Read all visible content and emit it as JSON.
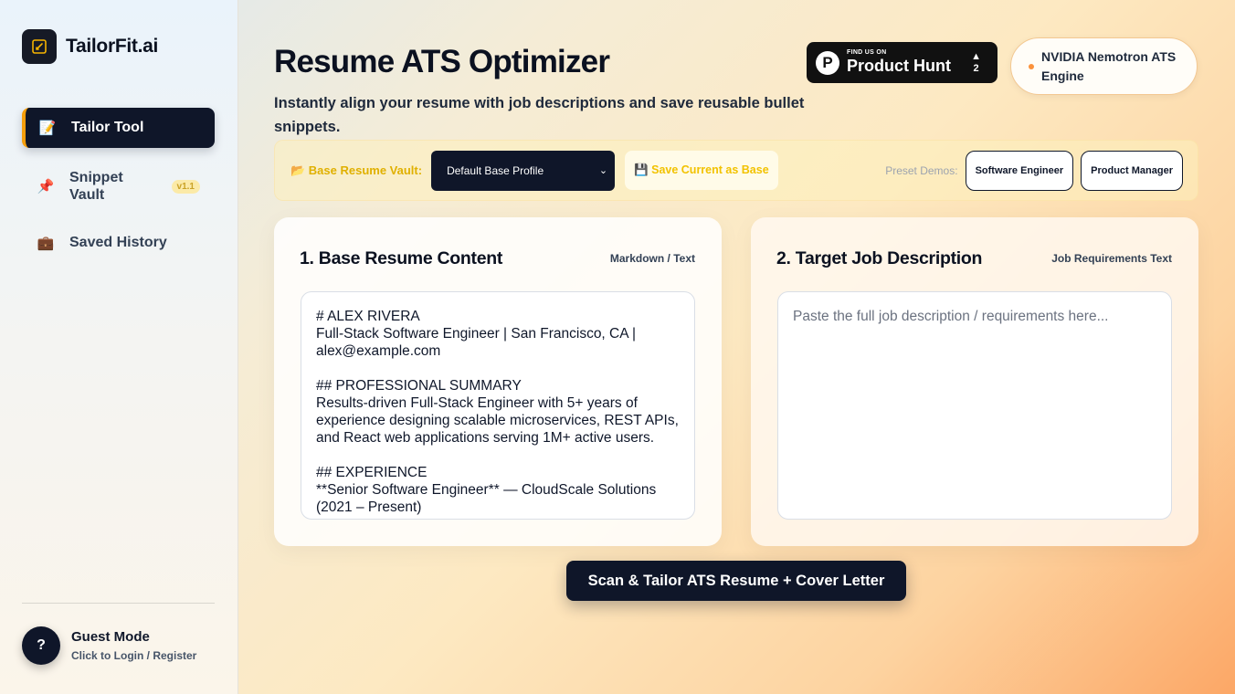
{
  "sidebar": {
    "brand": {
      "name": "TailorFit.ai",
      "logo_icon": "pen-square-icon"
    },
    "items": [
      {
        "label": "Tailor Tool",
        "icon": "📝",
        "active": true
      },
      {
        "label": "Snippet Vault",
        "icon": "📌",
        "badge": "v1.1"
      },
      {
        "label": "Saved History",
        "icon": "💼"
      }
    ],
    "guest": {
      "avatar": "?",
      "title": "Guest Mode",
      "subtitle": "Click to Login / Register"
    }
  },
  "header": {
    "title": "Resume ATS Optimizer",
    "subtitle": "Instantly align your resume with job descriptions and save reusable bullet snippets.",
    "product_hunt": {
      "small": "FIND US ON",
      "big": "Product Hunt",
      "logo": "P",
      "arrow": "▲",
      "votes": "2"
    },
    "engine": "NVIDIA Nemotron ATS Engine"
  },
  "vault": {
    "label": "📂 Base Resume Vault:",
    "selected": "Default Base Profile",
    "chevron": "⌄",
    "save_label": "💾 Save Current as Base",
    "preset_label": "Preset Demos:",
    "presets": [
      "Software Engineer",
      "Product Manager"
    ]
  },
  "resume_card": {
    "title": "1. Base Resume Content",
    "tag": "Markdown / Text",
    "content": "# ALEX RIVERA\nFull-Stack Software Engineer | San Francisco, CA | alex@example.com\n\n## PROFESSIONAL SUMMARY\nResults-driven Full-Stack Engineer with 5+ years of experience designing scalable microservices, REST APIs, and React web applications serving 1M+ active users.\n\n## EXPERIENCE\n**Senior Software Engineer** — CloudScale Solutions (2021 – Present)"
  },
  "job_card": {
    "title": "2. Target Job Description",
    "tag": "Job Requirements Text",
    "placeholder": "Paste the full job description / requirements here..."
  },
  "cta_label": "Scan & Tailor ATS Resume + Cover Letter",
  "colors": {
    "accent": "#f59e0b",
    "navy": "#0f1629",
    "vault_label": "#e0b000"
  }
}
